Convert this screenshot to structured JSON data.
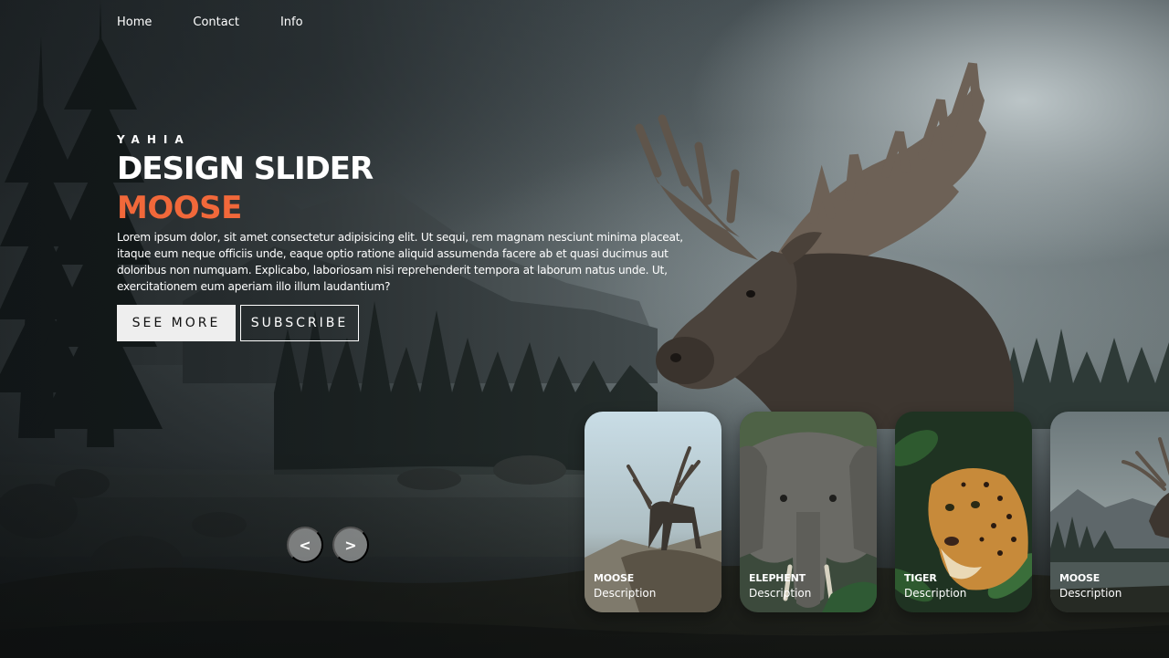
{
  "nav": {
    "items": [
      {
        "label": "Home"
      },
      {
        "label": "Contact"
      },
      {
        "label": "Info"
      }
    ]
  },
  "hero": {
    "author": "YAHIA",
    "title": "DESIGN SLIDER",
    "topic": "MOOSE",
    "description": "Lorem ipsum dolor, sit amet consectetur adipisicing elit. Ut sequi, rem magnam nesciunt minima placeat, itaque eum neque officiis unde, eaque optio ratione aliquid assumenda facere ab et quasi ducimus aut doloribus non numquam. Explicabo, laboriosam nisi reprehenderit tempora at laborum natus unde. Ut, exercitationem eum aperiam illo illum laudantium?",
    "see_more_label": "SEE MORE",
    "subscribe_label": "SUBSCRIBE"
  },
  "arrows": {
    "prev_label": "<",
    "next_label": ">"
  },
  "thumbnails": [
    {
      "title": "MOOSE",
      "description": "Description"
    },
    {
      "title": "ELEPHENT",
      "description": "Description"
    },
    {
      "title": "TIGER",
      "description": "Description"
    },
    {
      "title": "MOOSE",
      "description": "Description"
    }
  ],
  "colors": {
    "accent": "#f1683a",
    "see_more_bg": "#eeeeee",
    "arrow_bg": "rgba(238,238,238,0.45)"
  }
}
